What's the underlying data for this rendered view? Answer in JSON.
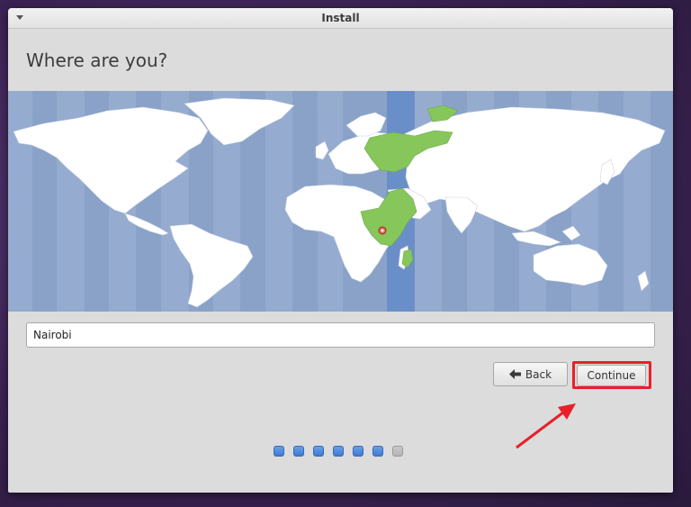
{
  "window": {
    "title": "Install"
  },
  "page": {
    "heading": "Where are you?"
  },
  "location": {
    "city_value": "Nairobi"
  },
  "buttons": {
    "back_label": "Back",
    "continue_label": "Continue"
  },
  "progress": {
    "total_steps": 7,
    "completed_steps": 6,
    "steps": [
      "done",
      "done",
      "done",
      "done",
      "done",
      "done",
      "todo"
    ]
  },
  "colors": {
    "map_ocean": "#8aa2c8",
    "map_land": "#ffffff",
    "selected_timezone_band": "#6a8fc8",
    "selected_region": "#86c65a",
    "annotation_red": "#e8202a",
    "progress_done": "#4a86dc"
  }
}
